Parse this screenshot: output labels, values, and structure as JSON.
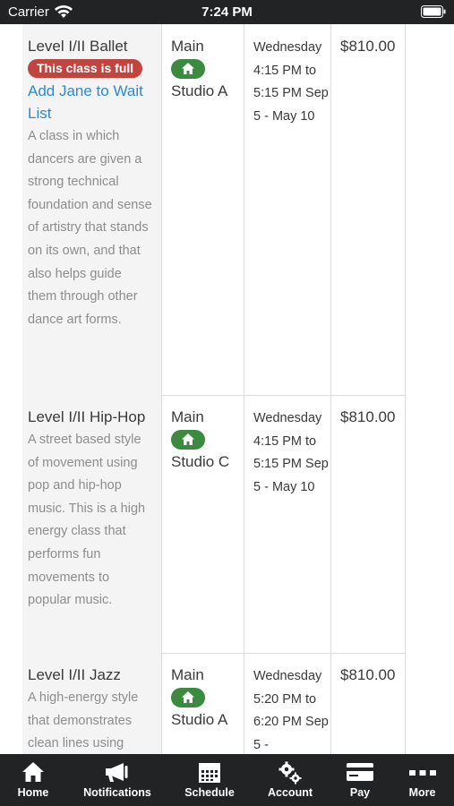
{
  "status_bar": {
    "carrier": "Carrier",
    "time": "7:24 PM"
  },
  "classes": [
    {
      "title": "Level I/II Ballet",
      "badge": "This class is full",
      "waitlist_link": "Add Jane to Wait List",
      "description": "A class in which dancers are given a strong technical foundation and sense of artistry that stands on its own, and that also helps guide them through other dance art forms.",
      "location_top": "Main",
      "location_bottom": "Studio A",
      "schedule": "Wednesday 4:15 PM to 5:15 PM Sep 5 - May 10",
      "price": "$810.00"
    },
    {
      "title": "Level I/II Hip-Hop",
      "description": "A street based style of movement using pop and hip-hop music. This is a high energy class that performs fun movements to popular music.",
      "location_top": "Main",
      "location_bottom": "Studio C",
      "schedule": "Wednesday 4:15 PM to 5:15 PM Sep 5 - May 10",
      "price": "$810.00"
    },
    {
      "title": "Level I/II Jazz",
      "description": "A high-energy style that demonstrates clean lines using",
      "location_top": "Main",
      "location_bottom": "Studio A",
      "schedule": "Wednesday 5:20 PM to 6:20 PM Sep 5 -",
      "price": "$810.00"
    }
  ],
  "tabs": [
    {
      "label": "Home",
      "icon": "home-icon"
    },
    {
      "label": "Notifications",
      "icon": "megaphone-icon"
    },
    {
      "label": "Schedule",
      "icon": "calendar-icon"
    },
    {
      "label": "Account",
      "icon": "gears-icon"
    },
    {
      "label": "Pay",
      "icon": "credit-card-icon"
    },
    {
      "label": "More",
      "icon": "more-icon"
    }
  ],
  "colors": {
    "bar_background": "#222325",
    "full_badge": "#c0453e",
    "location_badge": "#3a8a3f",
    "link": "#2a8ad6"
  }
}
